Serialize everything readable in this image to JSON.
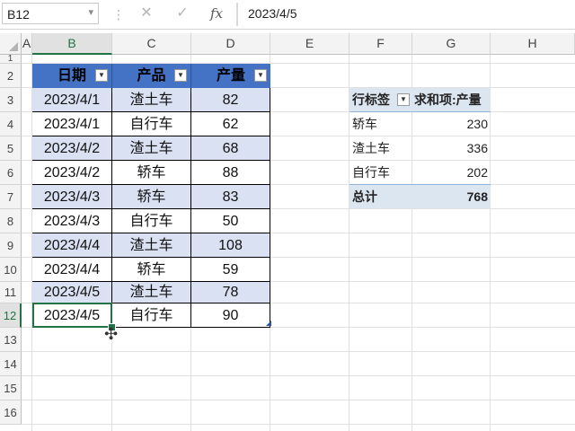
{
  "formula_bar": {
    "name_box": "B12",
    "cancel_icon": "✕",
    "enter_icon": "✓",
    "fx_label": "fx",
    "content": "2023/4/5"
  },
  "columns": [
    "A",
    "B",
    "C",
    "D",
    "E",
    "F",
    "G",
    "H"
  ],
  "rows": [
    "1",
    "2",
    "3",
    "4",
    "5",
    "6",
    "7",
    "8",
    "9",
    "10",
    "11",
    "12",
    "13",
    "14",
    "15",
    "16"
  ],
  "table": {
    "headers": [
      "日期",
      "产品",
      "产量"
    ],
    "rows": [
      [
        "2023/4/1",
        "渣土车",
        "82"
      ],
      [
        "2023/4/1",
        "自行车",
        "62"
      ],
      [
        "2023/4/2",
        "渣土车",
        "68"
      ],
      [
        "2023/4/2",
        "轿车",
        "88"
      ],
      [
        "2023/4/3",
        "轿车",
        "83"
      ],
      [
        "2023/4/3",
        "自行车",
        "50"
      ],
      [
        "2023/4/4",
        "渣土车",
        "108"
      ],
      [
        "2023/4/4",
        "轿车",
        "59"
      ],
      [
        "2023/4/5",
        "渣土车",
        "78"
      ],
      [
        "2023/4/5",
        "自行车",
        "90"
      ]
    ]
  },
  "pivot": {
    "row_label_header": "行标签",
    "value_header": "求和项:产量",
    "rows": [
      {
        "label": "轿车",
        "value": "230"
      },
      {
        "label": "渣土车",
        "value": "336"
      },
      {
        "label": "自行车",
        "value": "202"
      }
    ],
    "total_label": "总计",
    "total_value": "768"
  },
  "colors": {
    "excel_green": "#217346",
    "table_header": "#4472c4",
    "table_band": "#d9e1f2",
    "pivot_band": "#dce6f1"
  }
}
